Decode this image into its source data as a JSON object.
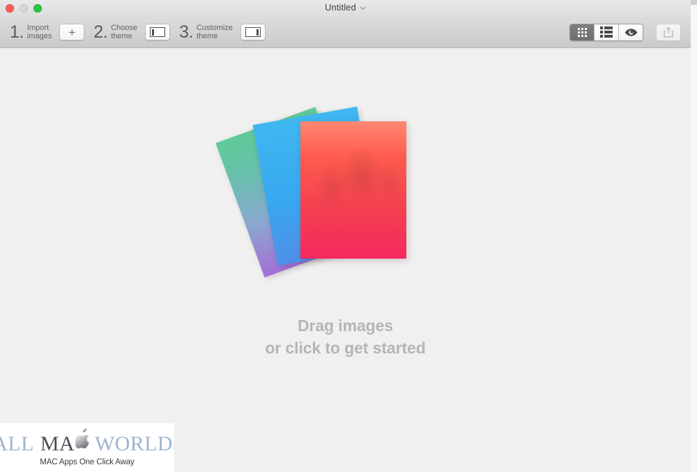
{
  "window": {
    "title": "Untitled",
    "title_chevron_icon": "chevron-down-icon",
    "traffic_lights": {
      "close_label": "Close",
      "minimize_label": "Minimize",
      "zoom_label": "Zoom"
    }
  },
  "toolbar": {
    "steps": [
      {
        "number": "1.",
        "label_line1": "Import",
        "label_line2": "images",
        "button_icon": "plus-icon",
        "button_name": "import-images-button"
      },
      {
        "number": "2.",
        "label_line1": "Choose",
        "label_line2": "theme",
        "button_icon": "theme-left-bar-icon",
        "button_name": "choose-theme-button"
      },
      {
        "number": "3.",
        "label_line1": "Customize",
        "label_line2": "theme",
        "button_icon": "theme-right-bar-icon",
        "button_name": "customize-theme-button"
      }
    ],
    "view_segment": {
      "options": [
        {
          "id": "grid",
          "icon": "grid-view-icon",
          "label": "Grid view",
          "selected": true
        },
        {
          "id": "list",
          "icon": "list-view-icon",
          "label": "List view",
          "selected": false
        },
        {
          "id": "preview",
          "icon": "eye-preview-icon",
          "label": "Preview",
          "selected": false
        }
      ],
      "selected": "grid"
    },
    "share": {
      "icon": "share-icon",
      "label": "Share",
      "enabled": false
    }
  },
  "content": {
    "dropzone": {
      "headline_line1": "Drag images",
      "headline_line2": "or click to get started",
      "cards": [
        {
          "id": "back",
          "icon": "image-card-green-purple",
          "gradient_from": "#5ecb96",
          "gradient_to": "#a46fd6"
        },
        {
          "id": "mid",
          "icon": "image-card-blue",
          "gradient_from": "#3fb7f0",
          "gradient_to": "#4f8fe8"
        },
        {
          "id": "front",
          "icon": "image-card-red",
          "gradient_from": "#ff7259",
          "gradient_to": "#fb2a5f"
        }
      ]
    }
  },
  "watermark": {
    "text_all": "ALL",
    "text_ma": "MA",
    "apple_icon": "apple-logo-icon",
    "text_w": "W",
    "text_orld": "ORLD",
    "text_s": "S",
    "tagline": "MAC Apps One Click Away"
  },
  "colors": {
    "toolbar_bg": "#d3d3d3",
    "content_bg": "#f0f0f0",
    "titlebar_bg": "#e4e4e4",
    "placeholder_text": "#b5b5b5",
    "segment_selected_bg": "#7e7e7e",
    "traffic_close": "#ff5f57",
    "traffic_min": "#d6d6d6",
    "traffic_zoom": "#28c940"
  }
}
